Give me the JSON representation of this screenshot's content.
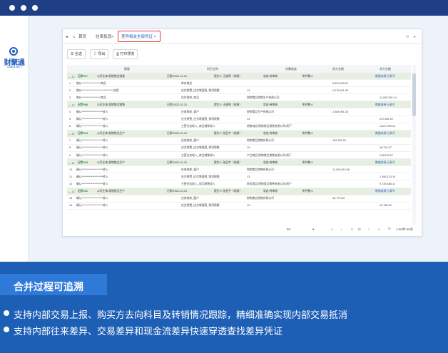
{
  "brand": {
    "logo_text": "财聚通",
    "logo_sub": "CAIKA.NET"
  },
  "nav": {
    "home": "首页",
    "tab2": "往来抵消",
    "active_tab": "差异相关全部凭证",
    "close": "×"
  },
  "toolbar": {
    "select_all": "全选",
    "export": "导出",
    "print": "打印预览"
  },
  "table": {
    "headers": [
      "摘要",
      "科目全称",
      "核算维度",
      "借方金额",
      "贷方金额"
    ],
    "rows": [
      {
        "type": "group",
        "code": "记字017",
        "title": "公司主体:部销售品销售",
        "date": "日期:2022-01-01",
        "maker": "提交人:王俊明（机制）",
        "status": "状态:待审核",
        "attach": "附件数:0",
        "link": "数据来源:分录号"
      },
      {
        "type": "line",
        "no": "1",
        "summary": "售价******************商品",
        "subject": "库存商品",
        "dim": "",
        "debit": "9,822,469.61",
        "credit": ""
      },
      {
        "type": "line",
        "no": "2",
        "summary": "售价******************************应税",
        "subject": "应交税费_应交增值税_销项税额",
        "dim": "13",
        "debit": "1,276,921.53",
        "credit": ""
      },
      {
        "type": "line",
        "no": "3",
        "summary": "售价******************商品",
        "subject": "应付账款_商品",
        "dim": "财物食品销售生产有限公司",
        "debit": "",
        "credit": "11,090,391.14"
      },
      {
        "type": "group",
        "code": "记字008",
        "title": "公司主体:部销售品销售",
        "date": "日期:2022-01-31",
        "maker": "提交人:王俊明（机制）",
        "status": "状态:待审核",
        "attach": "附件数:0",
        "link": "数据来源:分录号"
      },
      {
        "type": "line",
        "no": "4",
        "summary": "确认********************收入",
        "subject": "应收账款_客户",
        "dim": "财物食品生产有限公司",
        "debit": "2,364,961.33",
        "credit": ""
      },
      {
        "type": "line",
        "no": "5",
        "summary": "确认********************收入",
        "subject": "应交税费_应交增值税_销项税额",
        "dim": "13",
        "debit": "",
        "credit": "237,561.92"
      },
      {
        "type": "line",
        "no": "6",
        "summary": "确认********************收入",
        "subject": "主营业务收入_商品销售收入",
        "dim": "销售商品/财物食品销售有限公司/线下",
        "debit": "",
        "credit": "1,827,399.41"
      },
      {
        "type": "group",
        "code": "记字014",
        "title": "公司主体:部销售品生产",
        "date": "日期:2022-01-31",
        "maker": "提交人:张征宇（机制）",
        "status": "状态:待审核",
        "attach": "附件数:0",
        "link": "数据来源:分录号"
      },
      {
        "type": "line",
        "no": "7",
        "summary": "确认********************收入",
        "subject": "应收账款_客户",
        "dim": "财物食品销售有限公司",
        "debit": "162,583.29",
        "credit": ""
      },
      {
        "type": "line",
        "no": "8",
        "summary": "确认********************收入",
        "subject": "应交税费_应交增值税_销项税额",
        "dim": "13",
        "debit": "",
        "credit": "18,704.27"
      },
      {
        "type": "line",
        "no": "9",
        "summary": "确认********************收入",
        "subject": "主营业务收入_商品销售收入",
        "dim": "产品商品/财物食品销售有限公司/线下",
        "debit": "",
        "credit": "143,878.97"
      },
      {
        "type": "group",
        "code": "记字013",
        "title": "公司主体:部销售品生产",
        "date": "日期:2022-01-31",
        "maker": "提交人:张征宇（机制）",
        "status": "状态:待审核",
        "attach": "附件数:0",
        "link": "数据来源:分录号"
      },
      {
        "type": "line",
        "no": "10",
        "summary": "确认********************收入",
        "subject": "应收账款_客户",
        "dim": "财物食品销售有限公司",
        "debit": "11,005,619.36",
        "credit": ""
      },
      {
        "type": "line",
        "no": "11",
        "summary": "确认********************收入",
        "subject": "应交税费_应交增值税_销项税额",
        "dim": "13",
        "debit": "",
        "credit": "1,266,133.19"
      },
      {
        "type": "line",
        "no": "12",
        "summary": "确认********************收入",
        "subject": "主营业务收入_商品销售收入",
        "dim": "财务食品/财物食品销售有限公司/线下",
        "debit": "",
        "credit": "9,739,486.11"
      },
      {
        "type": "group",
        "code": "记字012",
        "title": "公司主体:部销售品生产",
        "date": "日期:2022-01-31",
        "maker": "提交人:张征宇（机制）",
        "status": "状态:待审核",
        "attach": "附件数:0",
        "link": "数据来源:分录号"
      },
      {
        "type": "line",
        "no": "13",
        "summary": "确认********************收入",
        "subject": "应收账款_客户",
        "dim": "财物食品销售有限公司",
        "debit": "93,772.84",
        "credit": ""
      },
      {
        "type": "line",
        "no": "14",
        "summary": "确认********************收入",
        "subject": "应交税费_应交增值税_销项税额",
        "dim": "13",
        "debit": "",
        "credit": "10,788.02"
      }
    ]
  },
  "pager": {
    "page_size": "50",
    "page": "1",
    "total_pages": "/2",
    "summary": "1-50共 60条"
  },
  "caption": {
    "title": "合并过程可追溯",
    "bullets": [
      "支持内部交易上报、购买方去向科目及转销情况跟踪，精细准确实现内部交易抵消",
      "支持内部往来差异、交易差异和现金流差异快速穿透查找差异凭证"
    ]
  }
}
